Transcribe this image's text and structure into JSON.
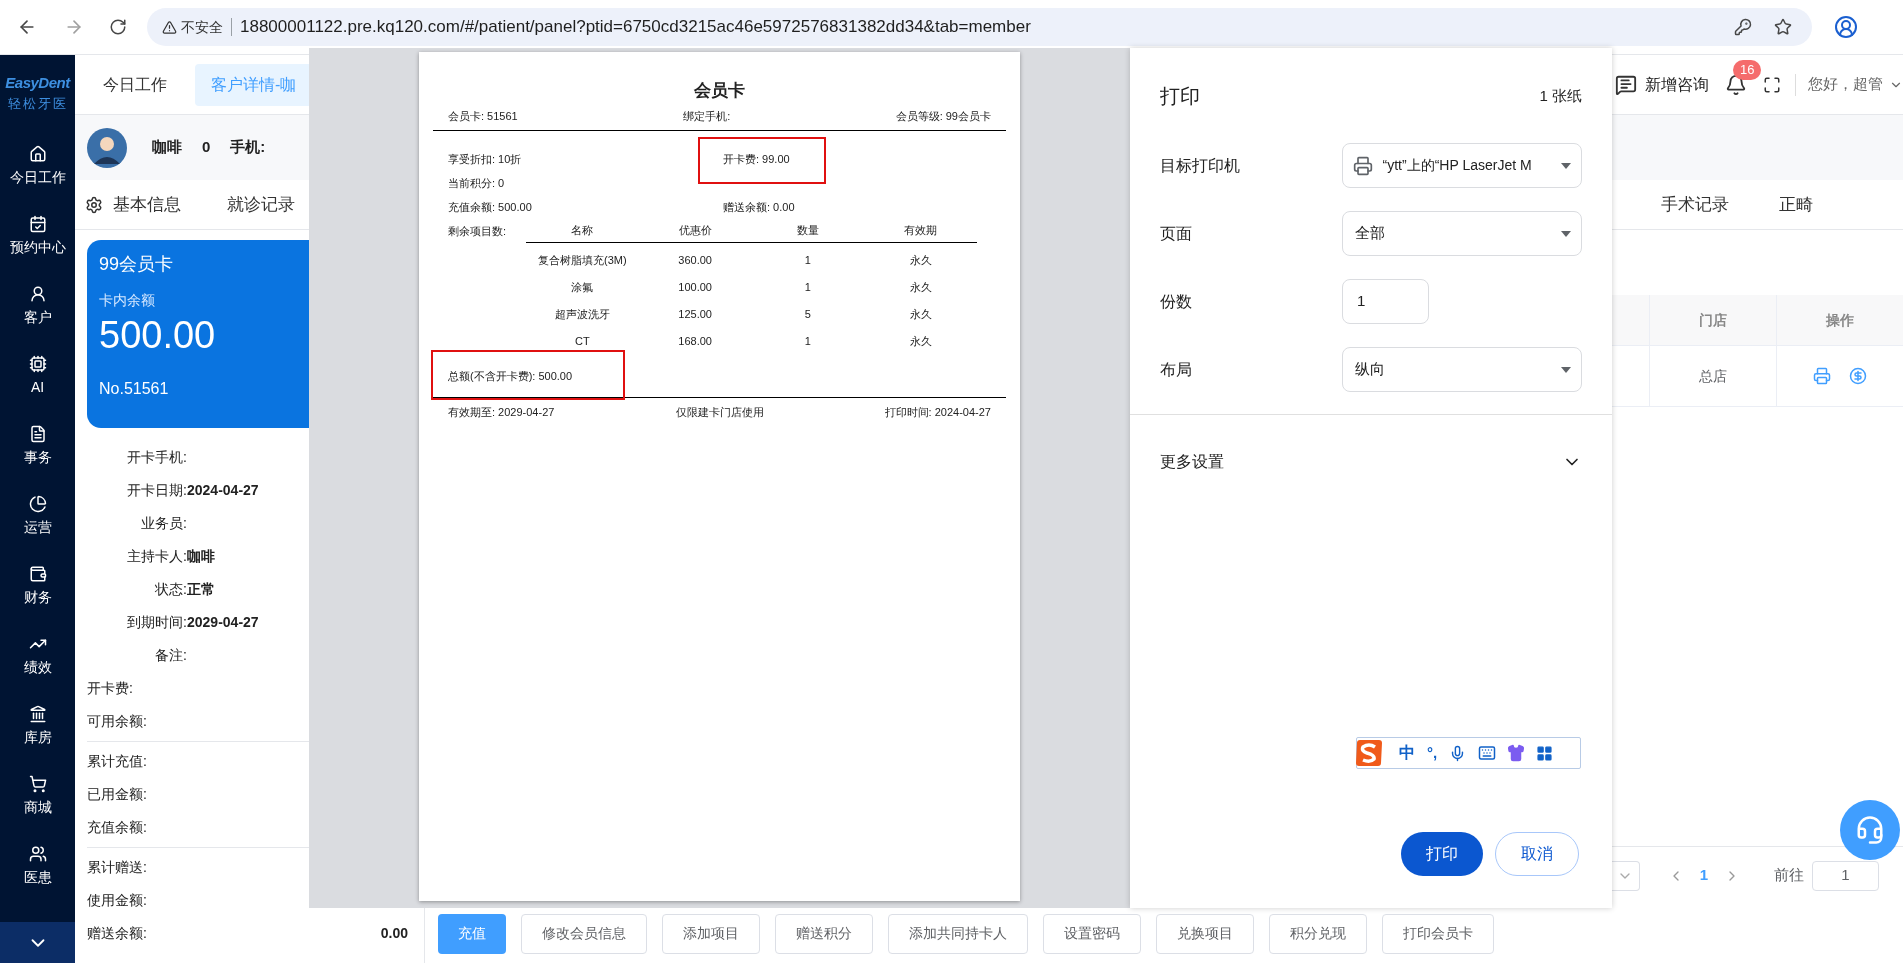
{
  "browser": {
    "security": "不安全",
    "url": "18800001122.pre.kq120.com/#/patient/panel?ptid=6750cd3215ac46e5972576831382dd34&tab=member"
  },
  "sidebar": {
    "logo": {
      "title": "EasyDent",
      "subtitle": "轻松牙医"
    },
    "items": [
      {
        "label": "今日工作"
      },
      {
        "label": "预约中心"
      },
      {
        "label": "客户"
      },
      {
        "label": "AI"
      },
      {
        "label": "事务"
      },
      {
        "label": "运营"
      },
      {
        "label": "财务"
      },
      {
        "label": "绩效"
      },
      {
        "label": "库房"
      },
      {
        "label": "商城"
      },
      {
        "label": "医患"
      }
    ]
  },
  "page_tabs": [
    {
      "label": "今日工作",
      "selected": false
    },
    {
      "label": "客户详情-咖",
      "selected": true
    }
  ],
  "header_right": {
    "consult": "新增咨询",
    "notifications": "16",
    "greeting": "您好，超管"
  },
  "patient": {
    "name": "咖啡",
    "count": "0",
    "phone_label": "手机:"
  },
  "detail_tabs": [
    {
      "label": "基本信息"
    },
    {
      "label": "就诊记录"
    },
    {
      "label": "手术记录"
    },
    {
      "label": "正畸"
    }
  ],
  "member_card": {
    "name": "99会员卡",
    "balance_label": "卡内余额",
    "balance": "500.00",
    "number": "No.51561"
  },
  "card_info": [
    {
      "label": "开卡手机:"
    },
    {
      "label": "开卡日期:",
      "value": "2024-04-27"
    },
    {
      "label": "业务员:"
    },
    {
      "label": "主持卡人:",
      "value": "咖啡"
    },
    {
      "label": "状态:",
      "value": "正常"
    },
    {
      "label": "到期时间:",
      "value": "2029-04-27"
    },
    {
      "label": "备注:"
    }
  ],
  "amount_groups": [
    [
      {
        "label": "开卡费:"
      },
      {
        "label": "可用余额:"
      }
    ],
    [
      {
        "label": "累计充值:"
      },
      {
        "label": "已用金额:"
      },
      {
        "label": "充值余额:"
      }
    ],
    [
      {
        "label": "累计赠送:"
      },
      {
        "label": "使用金额:"
      },
      {
        "label": "赠送余额:",
        "value": "0.00"
      }
    ]
  ],
  "table": {
    "columns": [
      "门店",
      "操作"
    ],
    "rows": [
      {
        "store": "总店"
      }
    ]
  },
  "pagination": {
    "page": "1",
    "goto_label": "前往",
    "goto_value": "1"
  },
  "actions": [
    {
      "label": "充值",
      "kind": "primary"
    },
    {
      "label": "修改会员信息",
      "kind": "default"
    },
    {
      "label": "添加项目",
      "kind": "default"
    },
    {
      "label": "赠送积分",
      "kind": "default"
    },
    {
      "label": "添加共同持卡人",
      "kind": "default"
    },
    {
      "label": "设置密码",
      "kind": "default"
    },
    {
      "label": "兑换项目",
      "kind": "default"
    },
    {
      "label": "积分兑现",
      "kind": "default"
    },
    {
      "label": "打印会员卡",
      "kind": "default"
    }
  ],
  "print_preview": {
    "title": "会员卡",
    "header": [
      "会员卡: 51561",
      "绑定手机:",
      "会员等级: 99会员卡"
    ],
    "discount": "享受折扣: 10折",
    "card_fee": {
      "text": "开卡费: 99.00",
      "highlighted": true
    },
    "points": "当前积分: 0",
    "recharge_balance": "充值余额: 500.00",
    "gift_balance": "赠送余额: 0.00",
    "items_label": "剩余项目数:",
    "items_table": {
      "columns": [
        "名称",
        "优惠价",
        "数量",
        "有效期"
      ],
      "rows": [
        [
          "复合树脂填充(3M)",
          "360.00",
          "1",
          "永久"
        ],
        [
          "涂氟",
          "100.00",
          "1",
          "永久"
        ],
        [
          "超声波洗牙",
          "125.00",
          "5",
          "永久"
        ],
        [
          "CT",
          "168.00",
          "1",
          "永久"
        ]
      ]
    },
    "total": {
      "text": "总额(不含开卡费): 500.00",
      "highlighted": true
    },
    "footer": [
      "有效期至: 2029-04-27",
      "仅限建卡门店使用",
      "打印时间: 2024-04-27"
    ]
  },
  "print_dialog": {
    "title": "打印",
    "sheets": "1 张纸",
    "fields": [
      {
        "label": "目标打印机",
        "kind": "printer",
        "value": "“ytt”上的“HP LaserJet M"
      },
      {
        "label": "页面",
        "kind": "select",
        "value": "全部"
      },
      {
        "label": "份数",
        "kind": "number",
        "value": "1"
      },
      {
        "label": "布局",
        "kind": "select",
        "value": "纵向"
      }
    ],
    "more": "更多设置",
    "buttons": [
      {
        "label": "打印",
        "kind": "primary"
      },
      {
        "label": "取消",
        "kind": "secondary"
      }
    ]
  },
  "ime_toolbar": {
    "mode": "中",
    "punctuation": "°,"
  }
}
